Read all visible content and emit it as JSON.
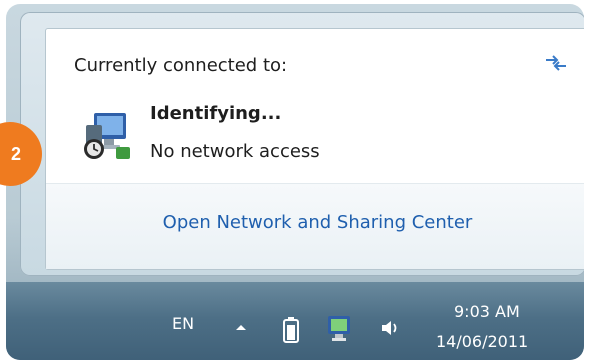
{
  "flyout": {
    "heading": "Currently connected to:",
    "network": {
      "name": "Identifying...",
      "status": "No network access"
    },
    "link": "Open Network and Sharing Center"
  },
  "badge": {
    "number": "2",
    "color": "#ef7b1f"
  },
  "taskbar": {
    "language": "EN",
    "tray_icons": [
      "show-hidden-arrow-icon",
      "battery-icon",
      "network-icon",
      "volume-icon"
    ],
    "clock": {
      "time": "9:03 AM",
      "date": "14/06/2011"
    }
  },
  "colors": {
    "link": "#1f5fae",
    "taskbar": "#4d6f86"
  }
}
